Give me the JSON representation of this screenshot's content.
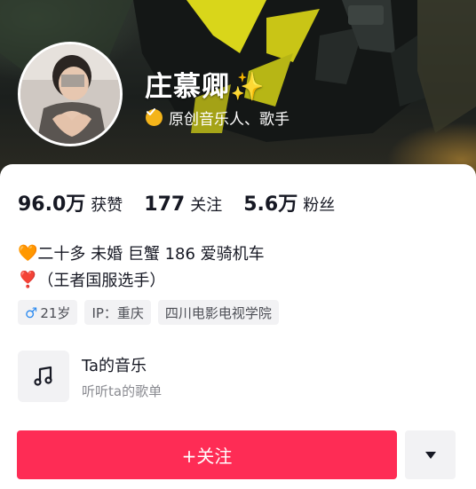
{
  "profile": {
    "name": "庄慕卿",
    "name_emoji": "✨",
    "verification": "原创音乐人、歌手"
  },
  "stats": [
    {
      "value": "96.0万",
      "label": "获赞"
    },
    {
      "value": "177",
      "label": "关注"
    },
    {
      "value": "5.6万",
      "label": "粉丝"
    }
  ],
  "bio": {
    "line1_emoji": "🧡",
    "line1": "二十多 未婚 巨蟹 186 爱骑机车",
    "line2_emoji": "❣️",
    "line2": "（王者国服选手）"
  },
  "tags": {
    "gender_symbol": "♂",
    "age": "21岁",
    "ip": "IP：重庆",
    "school": "四川电影电视学院"
  },
  "music": {
    "title": "Ta的音乐",
    "subtitle": "听听ta的歌单"
  },
  "actions": {
    "follow_label": "+关注"
  },
  "colors": {
    "accent": "#fe2c55",
    "verify_badge": "#f4b41a",
    "gender": "#2f8cf0"
  }
}
